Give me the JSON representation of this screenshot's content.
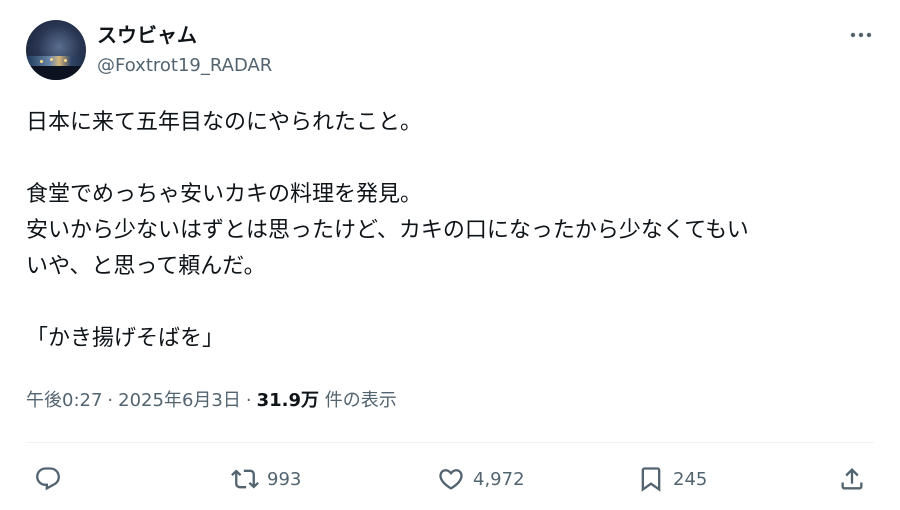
{
  "author": {
    "display_name": "スウビャム",
    "handle": "@Foxtrot19_RADAR"
  },
  "tweet": {
    "lines": [
      "日本に来て五年目なのにやられたこと。",
      "",
      "食堂でめっちゃ安いカキの料理を発見。",
      "安いから少ないはずとは思ったけど、カキの口になったから少なくてもい",
      "いや、と思って頼んだ。",
      "",
      "「かき揚げそばを」"
    ]
  },
  "meta": {
    "time": "午後0:27",
    "separator": "·",
    "date": "2025年6月3日",
    "views_count": "31.9万",
    "views_label": " 件の表示"
  },
  "actions": {
    "replies": "",
    "retweets": "993",
    "likes": "4,972",
    "bookmarks": "245"
  },
  "icons": {
    "more": "more-dots-icon",
    "reply": "reply-bubble-icon",
    "retweet": "retweet-arrows-icon",
    "like": "heart-icon",
    "bookmark": "bookmark-icon",
    "share": "share-upload-icon"
  },
  "colors": {
    "text_primary": "#0f1419",
    "text_secondary": "#536471",
    "divider": "#eff3f4"
  }
}
